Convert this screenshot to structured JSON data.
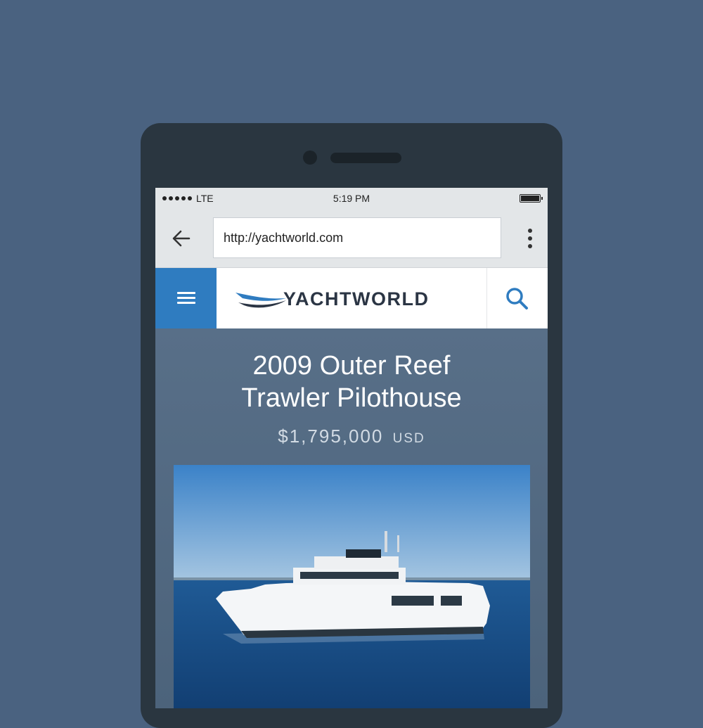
{
  "status_bar": {
    "network": "LTE",
    "time": "5:19 PM"
  },
  "browser": {
    "url": "http://yachtworld.com"
  },
  "site": {
    "logo_text": "YACHTWORLD",
    "brand_color": "#2f7cc0",
    "icons": [
      "hamburger-icon",
      "search-icon",
      "back-arrow-icon",
      "more-vert-icon"
    ]
  },
  "listing": {
    "title_line1": "2009 Outer Reef",
    "title_line2": "Trawler Pilothouse",
    "price": "$1,795,000",
    "currency": "USD"
  }
}
